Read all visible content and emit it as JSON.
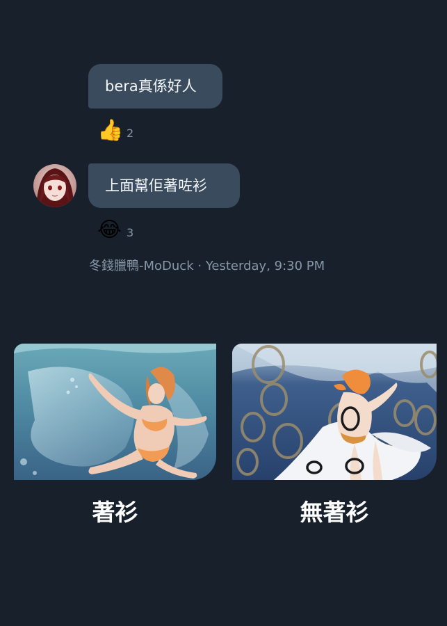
{
  "messages": [
    {
      "text": "bera真係好人",
      "reaction": {
        "emoji": "👍",
        "count": "2"
      }
    },
    {
      "text": "上面幫佢著咗衫",
      "reaction": {
        "emoji": "😂",
        "count": "3"
      }
    }
  ],
  "meta": {
    "sender": "冬錢臘鴨-MoDuck",
    "separator": " · ",
    "time": "Yesterday, 9:30 PM"
  },
  "images": [
    {
      "caption": "著衫"
    },
    {
      "caption": "無著衫"
    }
  ],
  "colors": {
    "background": "#18202b",
    "bubble": "#3a4b5d",
    "meta_text": "#8797a8"
  }
}
